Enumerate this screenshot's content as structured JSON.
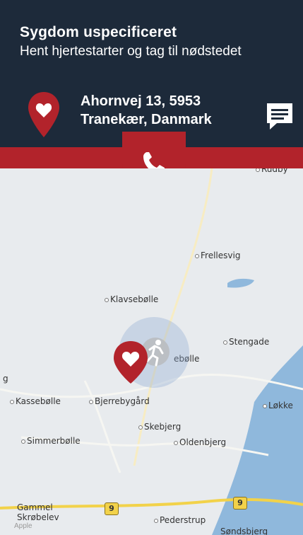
{
  "status_bar": {
    "left": "",
    "center": "",
    "right": ""
  },
  "header": {
    "title": "Sygdom uspecificeret",
    "subtitle": "Hent hjertestarter og tag til nødstedet",
    "address": "Ahornvej 13, 5953 Tranekær, Danmark",
    "chat_icon": "chat-icon",
    "pin_icon": "heart-pin-icon"
  },
  "call_button": {
    "icon": "phone-icon"
  },
  "map": {
    "places": {
      "rudby": "Rudby",
      "frellesvig": "Frellesvig",
      "klavsebolle": "Klavsebølle",
      "stengade": "Stengade",
      "center_town": "ebølle",
      "kassebolle": "Kassebølle",
      "bjerrebygaard": "Bjerrebygård",
      "lokke": "Løkke",
      "skebjerg": "Skebjerg",
      "simmerbolle": "Simmerbølle",
      "oldenbjerg": "Oldenbjerg",
      "gammel": "Gammel",
      "skrobelev": "Skrøbelev",
      "pederstrup": "Pederstrup",
      "sondsbjerg": "Søndsbjerg",
      "left_edge": "g"
    },
    "road_badges": [
      "9",
      "9"
    ],
    "watermark": "Apple"
  },
  "colors": {
    "header_bg": "#1d2a3a",
    "accent_red": "#b2232b",
    "map_bg": "#e8ebee",
    "water": "#8fb8dc",
    "road": "#f2d24a"
  }
}
